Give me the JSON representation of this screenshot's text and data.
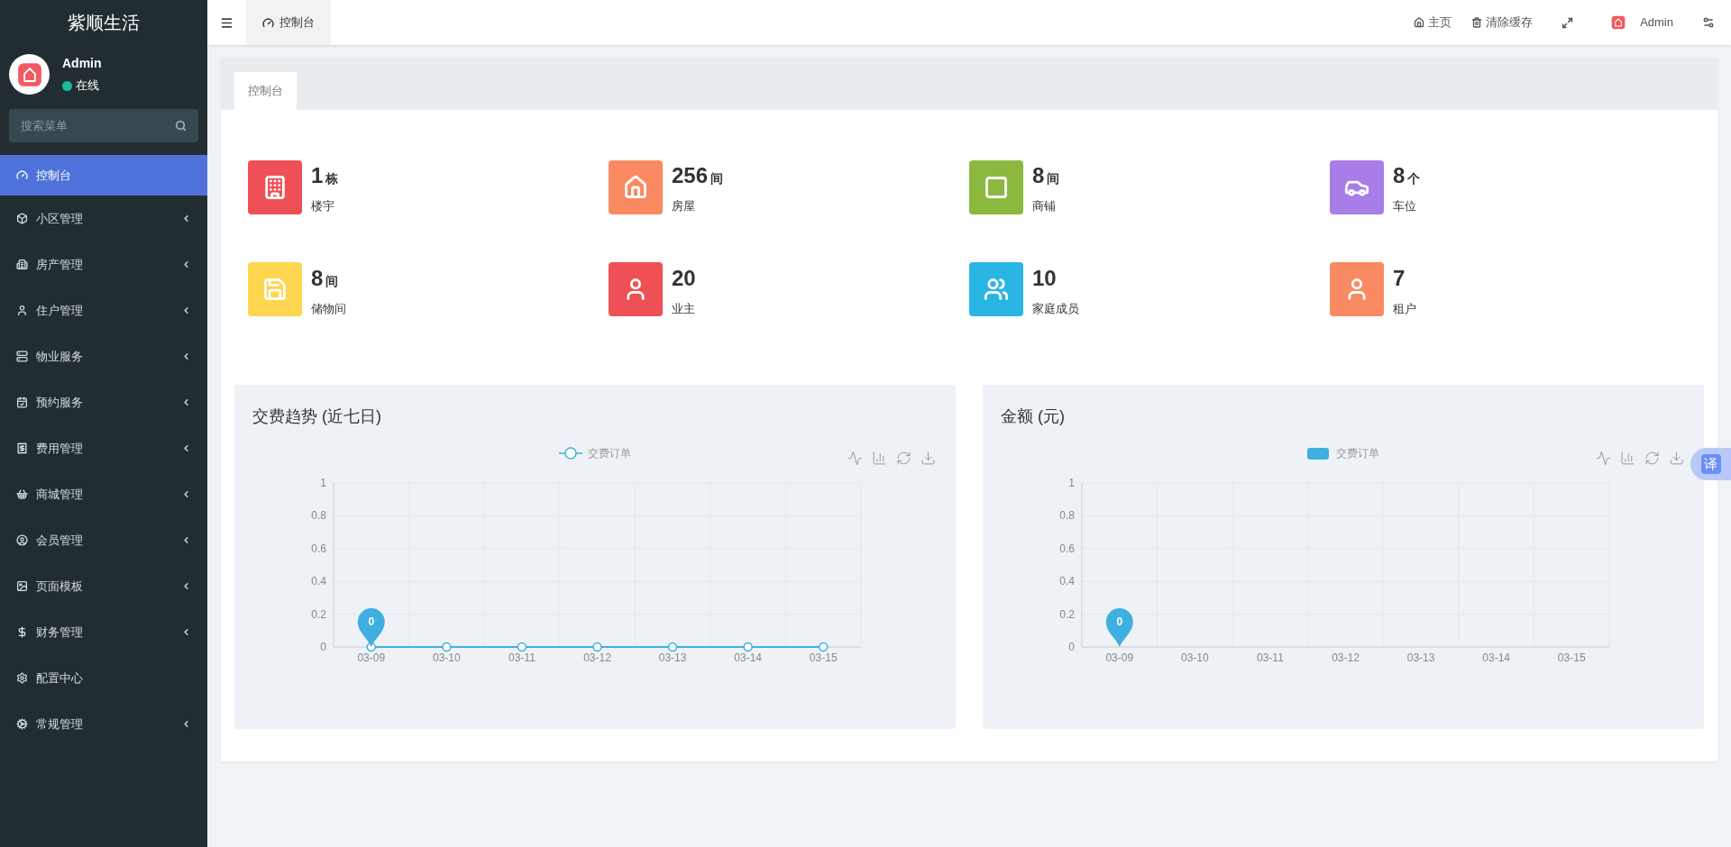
{
  "sidebar": {
    "brand": "紫顺生活",
    "user": {
      "name": "Admin",
      "status": "在线",
      "online": true
    },
    "search": {
      "placeholder": "搜索菜单"
    },
    "items": [
      {
        "label": "控制台",
        "selected": true,
        "has_children": false
      },
      {
        "label": "小区管理",
        "selected": false,
        "has_children": true
      },
      {
        "label": "房产管理",
        "selected": false,
        "has_children": true
      },
      {
        "label": "住户管理",
        "selected": false,
        "has_children": true
      },
      {
        "label": "物业服务",
        "selected": false,
        "has_children": true
      },
      {
        "label": "预约服务",
        "selected": false,
        "has_children": true
      },
      {
        "label": "费用管理",
        "selected": false,
        "has_children": true
      },
      {
        "label": "商城管理",
        "selected": false,
        "has_children": true
      },
      {
        "label": "会员管理",
        "selected": false,
        "has_children": true
      },
      {
        "label": "页面模板",
        "selected": false,
        "has_children": true
      },
      {
        "label": "财务管理",
        "selected": false,
        "has_children": true
      },
      {
        "label": "配置中心",
        "selected": false,
        "has_children": false
      },
      {
        "label": "常规管理",
        "selected": false,
        "has_children": true
      }
    ]
  },
  "header": {
    "tabs": [
      {
        "label": "控制台",
        "selected": true
      }
    ],
    "links": [
      "主页",
      "清除缓存"
    ],
    "user": "Admin"
  },
  "content_tabs": [
    {
      "label": "控制台",
      "selected": true
    }
  ],
  "stats": [
    {
      "value": "1",
      "unit": "栋",
      "label": "楼宇",
      "color": "#ef5055"
    },
    {
      "value": "256",
      "unit": "间",
      "label": "房屋",
      "color": "#f98a62"
    },
    {
      "value": "8",
      "unit": "间",
      "label": "商铺",
      "color": "#8bb93f"
    },
    {
      "value": "8",
      "unit": "个",
      "label": "车位",
      "color": "#a87de8"
    },
    {
      "value": "8",
      "unit": "间",
      "label": "储物间",
      "color": "#fdd54f"
    },
    {
      "value": "20",
      "label": "业主",
      "color": "#ef5055"
    },
    {
      "value": "10",
      "label": "家庭成员",
      "color": "#2ab6e5"
    },
    {
      "value": "7",
      "label": "租户",
      "color": "#f98a62"
    }
  ],
  "charts": [
    {
      "chart_data": {
        "type": "line",
        "title": "交费趋势 (近七日)",
        "categories": [
          "03-09",
          "03-10",
          "03-11",
          "03-12",
          "03-13",
          "03-14",
          "03-15"
        ],
        "series": [
          {
            "name": "交费订单",
            "color": "#3eafe0",
            "marker": "circle",
            "values": [
              0,
              0,
              0,
              0,
              0,
              0,
              0
            ]
          }
        ],
        "ylim": [
          0,
          1
        ],
        "yticks": [
          0,
          0.2,
          0.4,
          0.6,
          0.8,
          1
        ],
        "grid": true,
        "annotations": [
          {
            "x": "03-09",
            "y": 0,
            "text": "0"
          }
        ]
      }
    },
    {
      "chart_data": {
        "type": "bar",
        "title": "金额 (元)",
        "categories": [
          "03-09",
          "03-10",
          "03-11",
          "03-12",
          "03-13",
          "03-14",
          "03-15"
        ],
        "series": [
          {
            "name": "交费订单",
            "color": "#3eafe0",
            "values": [
              0,
              0,
              0,
              0,
              0,
              0,
              0
            ]
          }
        ],
        "ylim": [
          0,
          1
        ],
        "yticks": [
          0,
          0.2,
          0.4,
          0.6,
          0.8,
          1
        ],
        "grid": true,
        "annotations": [
          {
            "x": "03-09",
            "y": 0,
            "text": "0"
          }
        ]
      }
    }
  ],
  "translate_button": "译"
}
